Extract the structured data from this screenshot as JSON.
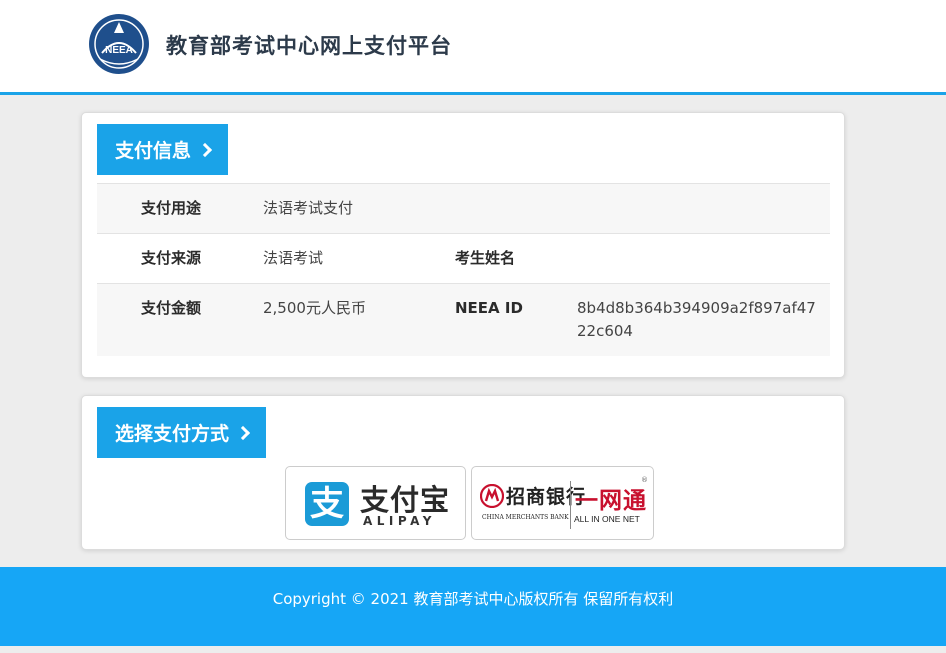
{
  "header": {
    "logo_text": "NEEA",
    "site_title": "教育部考试中心网上支付平台"
  },
  "payment_info": {
    "section_title": "支付信息",
    "rows": [
      {
        "label": "支付用途",
        "value": "法语考试支付"
      },
      {
        "label": "支付来源",
        "value": "法语考试",
        "label2": "考生姓名",
        "value2": ""
      },
      {
        "label": "支付金额",
        "value": "2,500元人民币",
        "label2": "NEEA ID",
        "value2": "8b4d8b364b394909a2f897af4722c604"
      }
    ]
  },
  "payment_method": {
    "section_title": "选择支付方式",
    "alipay": {
      "icon_char": "支",
      "name_cn": "支付宝",
      "name_en": "ALIPAY"
    },
    "cmb": {
      "name_cn": "招商银行",
      "name_en": "CHINA MERCHANTS BANK",
      "product_cn": "一网通",
      "product_en": "ALL IN ONE NET",
      "reg_mark": "®"
    }
  },
  "footer": {
    "copyright": "Copyright © 2021 教育部考试中心版权所有 保留所有权利"
  },
  "colors": {
    "accent": "#1aa3e8",
    "footer_bg": "#16a6f6",
    "page_bg": "#ededed",
    "cmb_red": "#c8102e",
    "alipay_blue": "#1b9bd7"
  }
}
